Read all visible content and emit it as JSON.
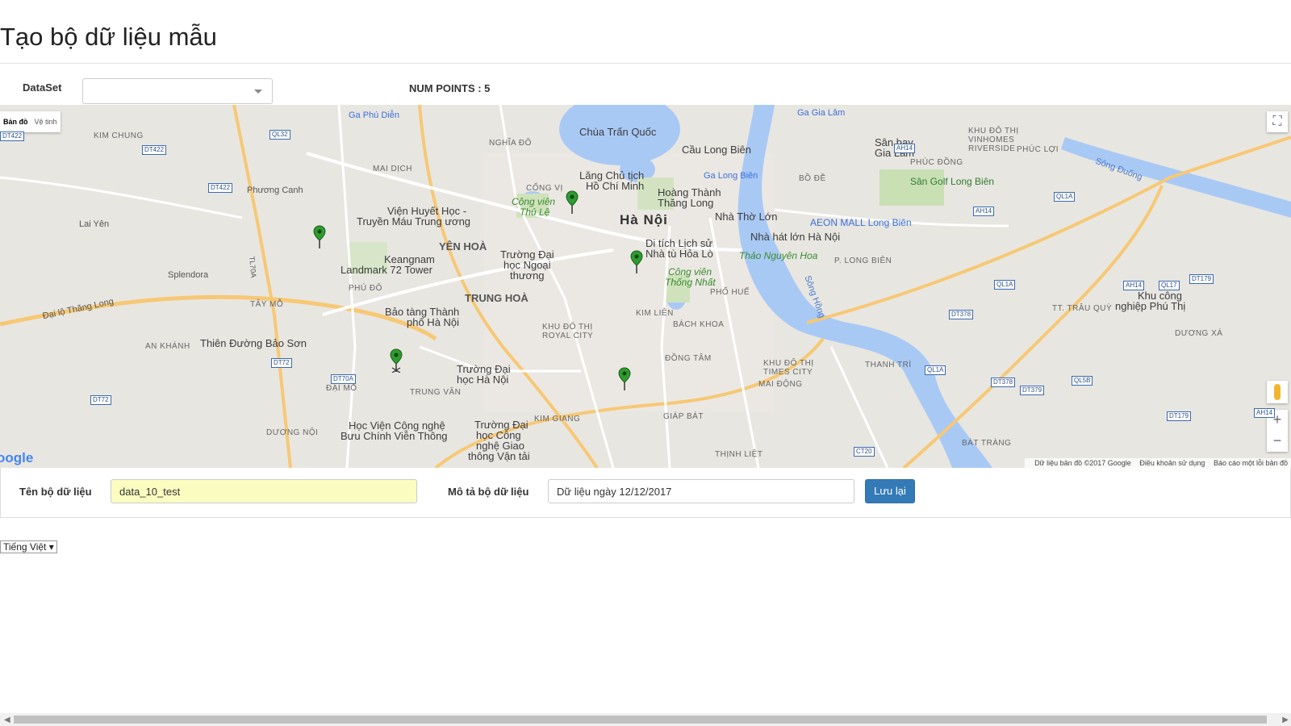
{
  "page": {
    "title": "Tạo bộ dữ liệu mẫu"
  },
  "dataset": {
    "label": "DataSet",
    "value": ""
  },
  "stats": {
    "num_points": "NUM POINTS : 5"
  },
  "map": {
    "type_controls": {
      "map": "Bản đồ",
      "satellite": "Vệ tinh"
    },
    "logo": "oogle",
    "attribution": {
      "data": "Dữ liệu bản đồ ©2017 Google",
      "terms": "Điều khoản sử dụng",
      "report": "Báo cáo một lỗi bản đồ"
    },
    "markers_count": 5,
    "labels": {
      "hanoi": "Hà Nội",
      "chua_tran_quoc": "Chùa Trấn Quốc",
      "cau_long_bien": "Cầu Long Biên",
      "lang_chu_tich": "Lăng Chủ tịch",
      "ho_chi_minh": "Hồ Chí Minh",
      "hoang_thanh": "Hoàng Thành",
      "thang_long": "Thăng Long",
      "nha_tho_lon": "Nhà Thờ Lớn",
      "nha_hat_lon": "Nhà hát lớn Hà Nội",
      "di_tich_hoa_lo": "Di tích Lịch sử",
      "nha_tu_hoa_lo": "Nhà tù Hỏa Lò",
      "cong_vien_thu_le_1": "Công viên",
      "cong_vien_thu_le_2": "Thủ Lệ",
      "cong_vien_thong_nhat_1": "Công viên",
      "cong_vien_thong_nhat_2": "Thống Nhất",
      "thao_nguyen_hoa": "Thảo Nguyên Hoa",
      "aeon_mall": "AEON MALL Long Biên",
      "san_bay_1": "Sân bay",
      "san_bay_2": "Gia Lâm",
      "san_golf": "Sân Golf Long Biên",
      "vien_huyet_hoc_1": "Viện Huyết Học -",
      "vien_huyet_hoc_2": "Truyền Máu Trung ương",
      "keangnam_1": "Keangnam",
      "keangnam_2": "Landmark 72 Tower",
      "dh_ngoai_thuong_1": "Trường Đại",
      "dh_ngoai_thuong_2": "học Ngoại",
      "dh_ngoai_thuong_3": "thương",
      "bao_tang_1": "Bảo tàng Thành",
      "bao_tang_2": "phố Hà Nội",
      "thien_duong": "Thiên Đường Bảo Sơn",
      "dh_ha_noi_1": "Trường Đại",
      "dh_ha_noi_2": "học Hà Nội",
      "hv_buu_chinh_1": "Học Viện Công nghệ",
      "hv_buu_chinh_2": "Bưu Chính Viễn Thông",
      "dh_cong_nghe_1": "Trường Đại",
      "dh_cong_nghe_2": "học Công",
      "dh_cong_nghe_3": "nghệ Giao",
      "dh_cong_nghe_4": "thông Vận tải",
      "khu_cong_nghiep_1": "Khu công",
      "khu_cong_nghiep_2": "nghiệp Phú Thị",
      "vinhomes_1": "KHU ĐÔ THỊ",
      "vinhomes_2": "VINHOMES",
      "vinhomes_3": "RIVERSIDE",
      "yen_hoa": "YÊN HOÀ",
      "trung_hoa": "TRUNG HOÀ",
      "kim_chung": "KIM CHUNG",
      "mai_dich": "MAI DỊCH",
      "nghia_do": "NGHĨA ĐÔ",
      "cong_vi": "CỐNG VỊ",
      "phu_do": "PHÚ ĐÔ",
      "tay_mo": "TÂY MỖ",
      "an_khanh": "AN KHÁNH",
      "dai_mo": "ĐẠI MỖ",
      "trung_van": "TRUNG VĂN",
      "duong_noi": "DƯƠNG NỘI",
      "kim_giang": "KIM GIANG",
      "royal_city_1": "KHU ĐÔ THỊ",
      "royal_city_2": "ROYAL CITY",
      "kim_lien": "KIM LIÊN",
      "bach_khoa": "BÁCH KHOA",
      "dong_tam": "ĐỒNG TÂM",
      "times_city_1": "KHU ĐÔ THỊ",
      "times_city_2": "TIMES CITY",
      "mai_dong": "MAI ĐỘNG",
      "giap_bat": "GIÁP BÁT",
      "thanh_tri": "THANH TRÌ",
      "bat_trang": "BÁT TRÀNG",
      "pho_hue": "PHỐ HUẾ",
      "bo_de": "BỒ ĐỀ",
      "phuc_dong": "PHÚC ĐỒNG",
      "phuc_loi": "PHÚC LỢI",
      "p_long_bien": "P. LONG BIÊN",
      "tt_trau_quy": "TT. TRÂU QUỲ",
      "duong_xa": "DƯƠNG XÁ",
      "dai_lo_thang_long": "Đại lộ Thăng Long",
      "song_hong": "Sông Hồng",
      "song_duong": "Sông Đuống",
      "ga_phu_dien": "Ga Phú Diễn",
      "ga_gia_lam": "Ga Gia Lâm",
      "ga_long_bien": "Ga Long Biên",
      "phuong_canh": "Phương Canh",
      "splendora": "Splendora",
      "lai_yen": "Lai Yên",
      "thinh_liet": "THỊNH LIỆT"
    },
    "shields": [
      "DT422",
      "DT422",
      "DT422",
      "QL32",
      "DT72",
      "DT72",
      "DT70A",
      "QL1A",
      "QL1A",
      "QL1A",
      "AH14",
      "AH14",
      "QL17",
      "DT179",
      "DT179",
      "DT378",
      "DT378",
      "DT379",
      "QL5B",
      "CT20",
      "AH14",
      "AH14",
      "TL70A"
    ]
  },
  "form": {
    "name_label": "Tên bộ dữ liệu",
    "name_value": "data_10_test",
    "desc_label": "Mô tả bộ dữ liệu",
    "desc_value": "Dữ liệu ngày 12/12/2017",
    "save_label": "Lưu lại"
  },
  "language": {
    "selected": "Tiếng Việt ▾"
  }
}
